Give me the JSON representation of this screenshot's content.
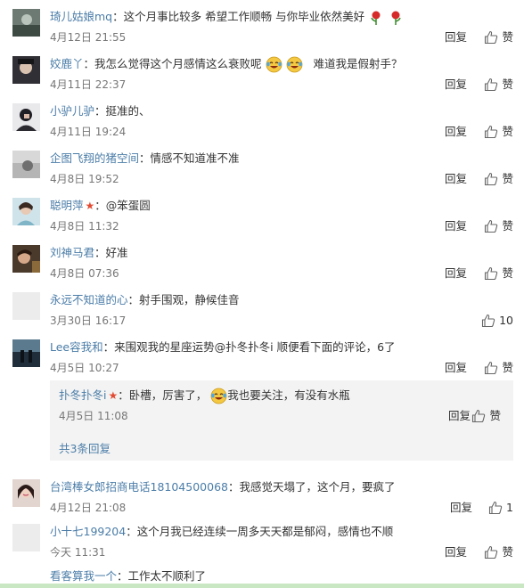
{
  "accent_color": "#4b7da8",
  "reply_label": "回复",
  "like_label": "赞",
  "comments": [
    {
      "user": "琦儿姑娘mq",
      "sep": "：",
      "text": "这个月事比较多 希望工作顺畅 与你毕业依然美好",
      "emoji": [
        "rose-icon",
        "rose-icon"
      ],
      "time": "4月12日 21:55",
      "likes": "赞"
    },
    {
      "user": "姣鹿丫",
      "sep": "：",
      "text": "我怎么觉得这个月感情这么衰败呢",
      "text2": "难道我是假射手？",
      "emoji": [
        "laugh-cry-icon",
        "laugh-cry-icon"
      ],
      "time": "4月11日 22:37",
      "likes": "赞"
    },
    {
      "user": "小驴儿驴",
      "sep": "：",
      "text": "挺准的、",
      "time": "4月11日 19:24",
      "likes": "赞"
    },
    {
      "user": "企图飞翔的猪空间",
      "sep": "：",
      "text": "情感不知道准不准",
      "time": "4月8日 19:52",
      "likes": "赞"
    },
    {
      "user": "聪明萍",
      "sep": "：",
      "text": "@笨蛋圆",
      "star": true,
      "time": "4月8日 11:32",
      "likes": "赞"
    },
    {
      "user": "刘神马君",
      "sep": "：",
      "text": "好准",
      "time": "4月8日 07:36",
      "likes": "赞"
    },
    {
      "user": "永远不知道的心",
      "sep": "：",
      "text": "射手围观，静候佳音",
      "time": "3月30日 16:17",
      "likes": "10"
    },
    {
      "user": "Lee容我和",
      "sep": "：",
      "text": "来围观我的星座运势@扑冬扑冬i 顺便看下面的评论，6了",
      "time": "4月5日 10:27",
      "likes": "赞"
    },
    {
      "user": "台湾棒女郎招商电话18104500068",
      "sep": "：",
      "text": "我感觉天塌了，这个月，要疯了",
      "time": "4月12日 21:08",
      "likes": "1"
    },
    {
      "user": "小十七199204",
      "sep": "：",
      "text": "这个月我已经连续一周多天天都是郁闷，感情也不顺",
      "time": "今天 11:31",
      "likes": "赞"
    },
    {
      "user": "看客算我一个",
      "sep": "：",
      "text": "工作太不顺利了"
    }
  ],
  "sub_reply": {
    "user": "扑冬扑冬i",
    "sep": "：",
    "text": "卧槽，厉害了，",
    "text2": "我也要关注，有没有水瓶",
    "star": true,
    "time": "4月5日 11:08",
    "likes": "赞",
    "more": "共3条回复"
  }
}
